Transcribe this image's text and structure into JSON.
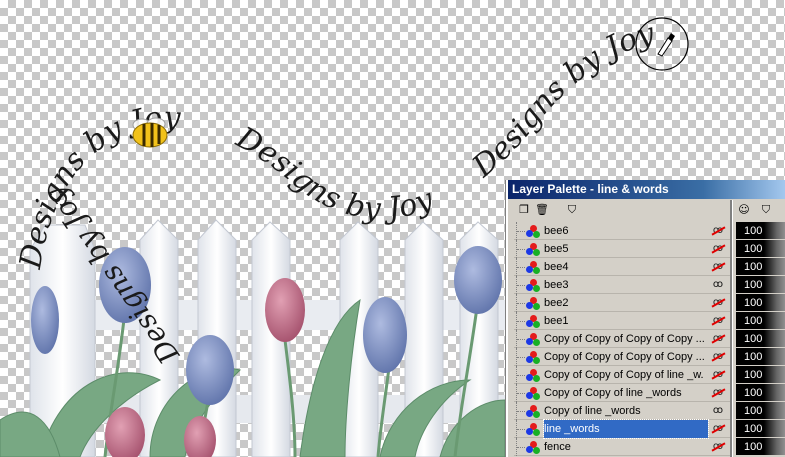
{
  "canvas": {
    "watermark_text": "Designs by Joy",
    "bee_icon": "bee-icon",
    "brush_icon": "brush-cursor-icon"
  },
  "palette": {
    "title": "Layer Palette - line & words",
    "toolbar_icons": [
      "new-layer-icon",
      "delete-layer-icon",
      "layer-mask-icon",
      "visibility-header-icon",
      "mask-header-icon"
    ],
    "layers": [
      {
        "name": "bee6",
        "visibility": "hidden",
        "opacity": "100"
      },
      {
        "name": "bee5",
        "visibility": "hidden",
        "opacity": "100"
      },
      {
        "name": "bee4",
        "visibility": "hidden",
        "opacity": "100"
      },
      {
        "name": "bee3",
        "visibility": "visible",
        "opacity": "100"
      },
      {
        "name": "bee2",
        "visibility": "hidden",
        "opacity": "100"
      },
      {
        "name": "bee1",
        "visibility": "hidden",
        "opacity": "100"
      },
      {
        "name": "Copy of Copy of Copy of Copy ...",
        "visibility": "hidden",
        "opacity": "100"
      },
      {
        "name": "Copy of Copy of Copy of Copy ...",
        "visibility": "hidden",
        "opacity": "100"
      },
      {
        "name": "Copy of Copy of Copy of line _w...",
        "visibility": "hidden",
        "opacity": "100"
      },
      {
        "name": "Copy of Copy of line _words",
        "visibility": "hidden",
        "opacity": "100"
      },
      {
        "name": "Copy of line _words",
        "visibility": "visible",
        "opacity": "100"
      },
      {
        "name": "line _words",
        "visibility": "hidden",
        "opacity": "100",
        "selected": true
      },
      {
        "name": "fence",
        "visibility": "hidden",
        "opacity": "100"
      }
    ]
  },
  "colors": {
    "title_bar": "#0a246a",
    "selection": "#316ac5",
    "panel": "#d4d0c8",
    "fence": "#f4f6f8",
    "tulip_blue": "#7f93c6",
    "tulip_pink": "#c06a85",
    "leaf": "#6f9e78"
  }
}
